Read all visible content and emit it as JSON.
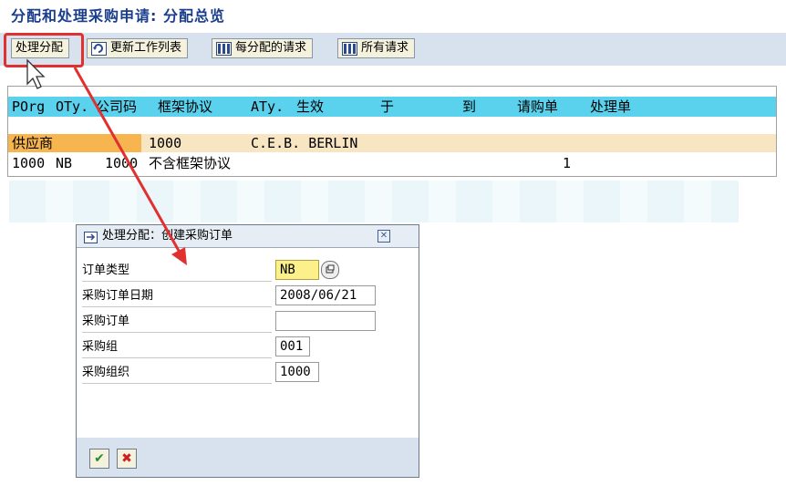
{
  "title": "分配和处理采购申请: 分配总览",
  "toolbar": {
    "process_label": "处理分配",
    "refresh_label": "更新工作列表",
    "per_assign_label": "每分配的请求",
    "all_requests_label": "所有请求"
  },
  "list": {
    "headers": [
      "POrg",
      "OTy.",
      "公司码",
      "框架协议",
      "ATy.",
      "生效",
      "于",
      "到",
      "请购单",
      "处理单"
    ],
    "row1": {
      "label": "供应商",
      "vendor": "1000",
      "name": "C.E.B. BERLIN"
    },
    "row2": {
      "porg": "1000",
      "otype": "NB",
      "company": "1000",
      "desc": "不含框架协议",
      "count": "1"
    }
  },
  "dialog": {
    "title": "处理分配：创建采购订单",
    "fields": {
      "order_type": {
        "label": "订单类型",
        "value": "NB"
      },
      "order_date": {
        "label": "采购订单日期",
        "value": "2008/06/21"
      },
      "po_number": {
        "label": "采购订单",
        "value": ""
      },
      "purch_group": {
        "label": "采购组",
        "value": "001"
      },
      "purch_org": {
        "label": "采购组织",
        "value": "1000"
      }
    },
    "ok_icon": "check-icon",
    "cancel_icon": "cross-icon"
  },
  "colors": {
    "title": "#1a3d8c",
    "header_bg": "#5ad2ee",
    "row_highlight": "#f6b54e",
    "row_bg": "#f8e6c2",
    "annotation_red": "#e03030"
  }
}
